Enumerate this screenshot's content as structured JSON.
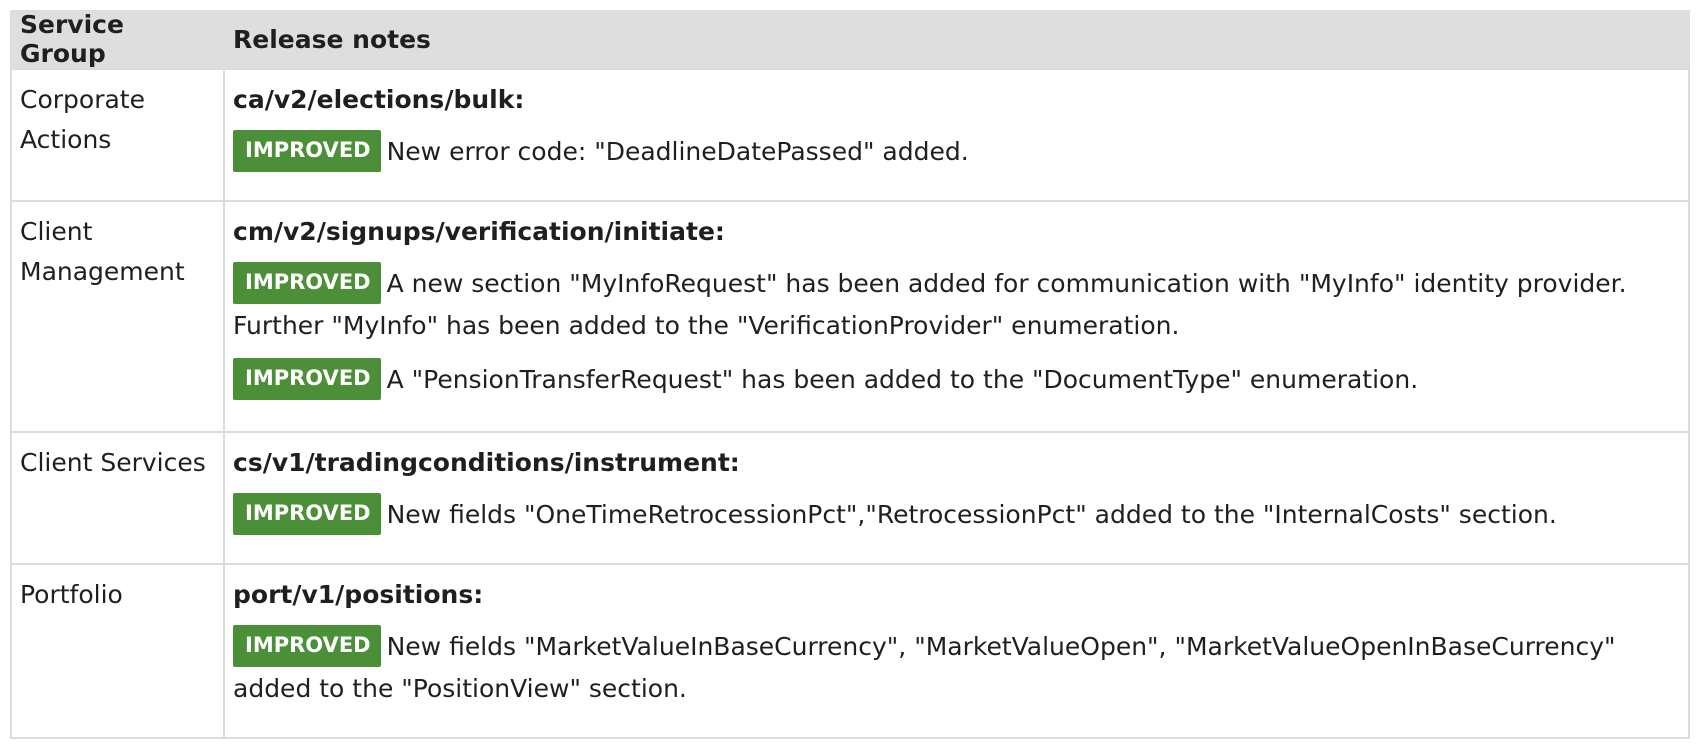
{
  "header": {
    "service_group": "Service Group",
    "release_notes": "Release notes"
  },
  "rows": [
    {
      "group": "Corporate Actions",
      "endpoint": "ca/v2/elections/bulk:",
      "notes": [
        {
          "badge": "IMPROVED",
          "text": "New error code: \"DeadlineDatePassed\" added."
        }
      ]
    },
    {
      "group": "Client Management",
      "endpoint": "cm/v2/signups/verification/initiate:",
      "notes": [
        {
          "badge": "IMPROVED",
          "text": "A new section \"MyInfoRequest\" has been added for communication with \"MyInfo\" identity provider. Further \"MyInfo\" has been added to the \"VerificationProvider\" enumeration."
        },
        {
          "badge": "IMPROVED",
          "text": "A \"PensionTransferRequest\" has been added to the \"DocumentType\" enumeration."
        }
      ]
    },
    {
      "group": "Client Services",
      "endpoint": "cs/v1/tradingconditions/instrument:",
      "notes": [
        {
          "badge": "IMPROVED",
          "text": "New fields \"OneTimeRetrocessionPct\",\"RetrocessionPct\" added to the \"InternalCosts\" section."
        }
      ]
    },
    {
      "group": "Portfolio",
      "endpoint": "port/v1/positions:",
      "notes": [
        {
          "badge": "IMPROVED",
          "text": "New fields \"MarketValueInBaseCurrency\", \"MarketValueOpen\",  \"MarketValueOpenInBaseCurrency\" added to the \"PositionView\" section."
        }
      ]
    }
  ],
  "colors": {
    "badge_bg": "#4b8f38",
    "header_bg": "#dedede",
    "border": "#dcdcdc"
  }
}
